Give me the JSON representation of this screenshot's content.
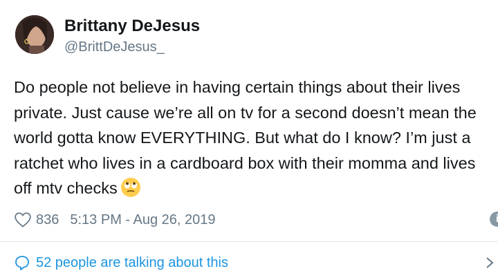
{
  "author": {
    "name": "Brittany DeJesus",
    "handle": "@BrittDeJesus_"
  },
  "tweet": {
    "text": "Do people not believe in having certain things about their lives private. Just cause we’re all on tv for a second doesn’t mean the world gotta know EVERYTHING. But what do I know? I’m just a ratchet who lives in a cardboard box with their momma and lives off mtv checks",
    "emoji": "face-with-rolling-eyes"
  },
  "meta": {
    "likes": "836",
    "timestamp": "5:13 PM - Aug 26, 2019"
  },
  "footer": {
    "talking_label": "52 people are talking about this"
  },
  "colors": {
    "link": "#1b95e0",
    "muted": "#657786",
    "text": "#14171a"
  }
}
